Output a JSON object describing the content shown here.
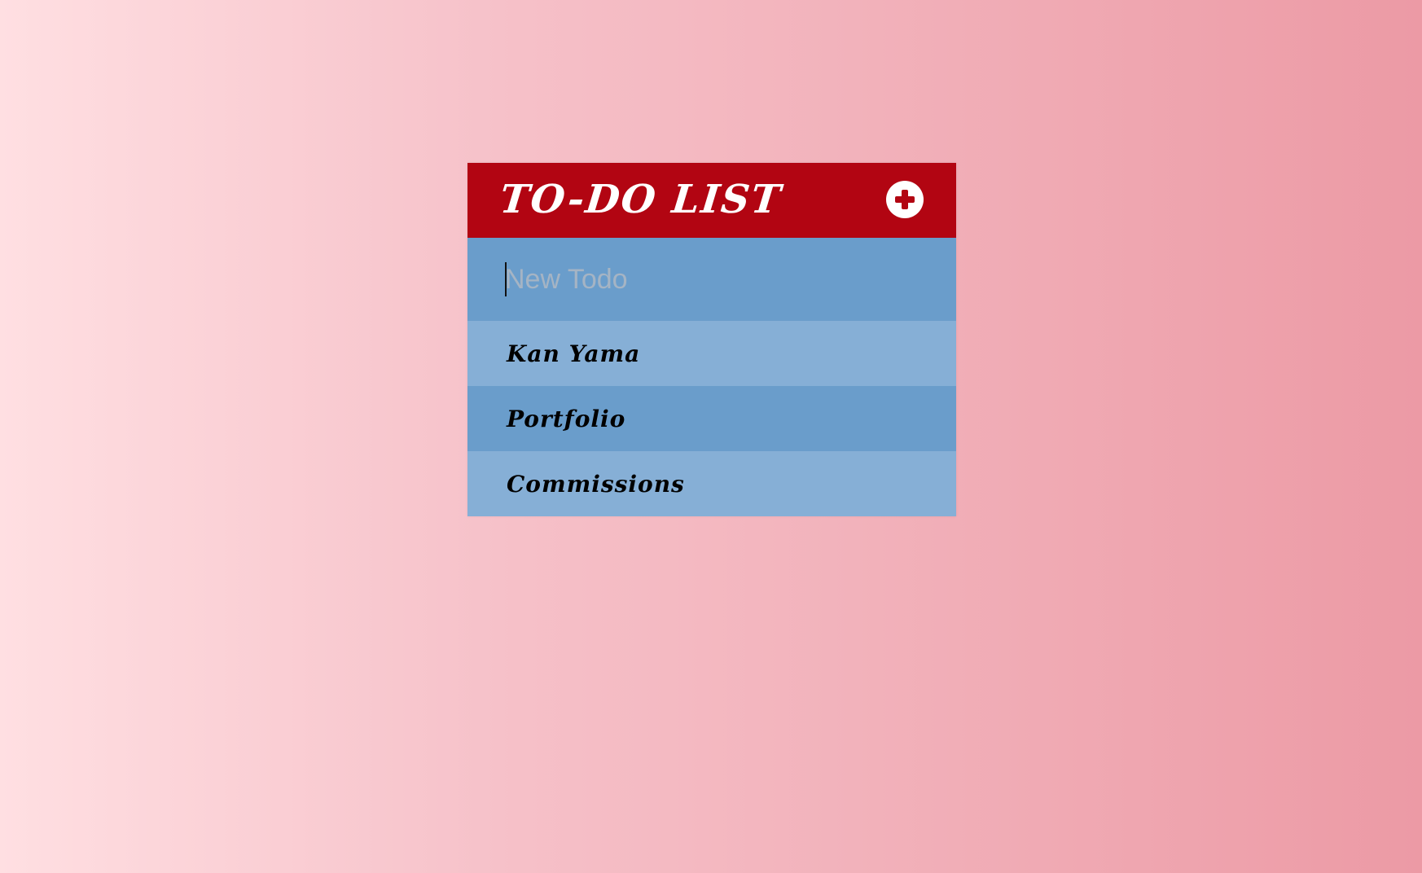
{
  "app": {
    "title": "TO-DO LIST"
  },
  "input": {
    "placeholder": "New Todo",
    "value": ""
  },
  "todos": [
    {
      "label": "Kan Yama"
    },
    {
      "label": "Portfolio"
    },
    {
      "label": "Commissions"
    }
  ],
  "colors": {
    "header": "#b20512",
    "input_row": "#6a9dcb",
    "item_light": "#86afd6",
    "item_dark": "#6a9dcb",
    "background_start": "#ffdfe2",
    "background_end": "#ec9aa5"
  },
  "icons": {
    "add": "plus-circle-icon"
  }
}
